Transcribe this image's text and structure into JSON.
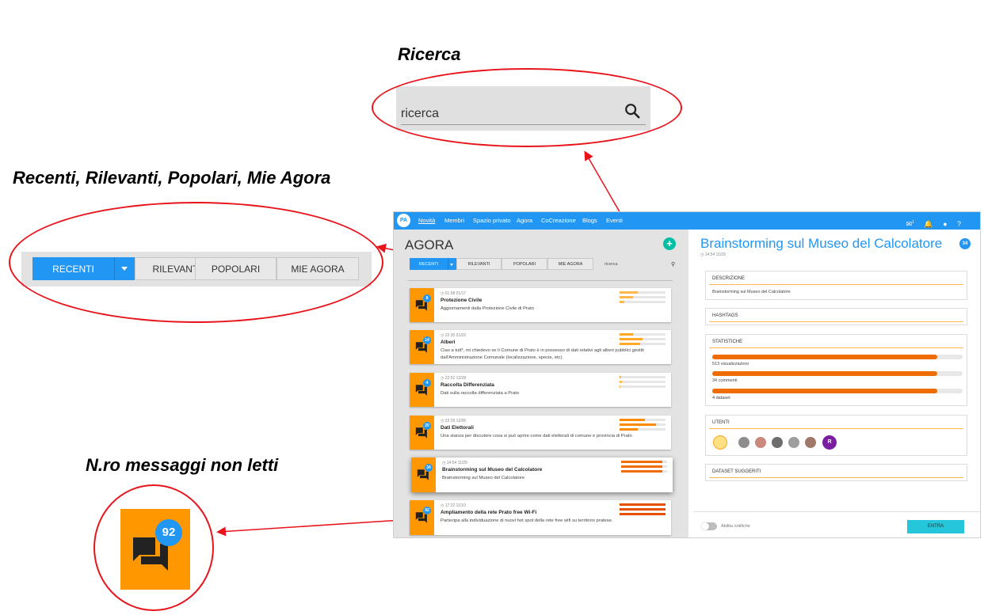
{
  "callouts": {
    "search_title": "Ricerca",
    "tabs_title": "Recenti, Rilevanti, Popolari, Mie Agora",
    "unread_title": "N.ro messaggi non letti",
    "search_placeholder": "ricerca",
    "tabs": [
      "RECENTI",
      "RILEVANTI",
      "POPOLARI",
      "MIE AGORA"
    ],
    "unread_count": "92"
  },
  "app": {
    "logo": "PA",
    "nav": [
      "Novità",
      "Membri",
      "Spazio privato",
      "Agora",
      "CoCreazione",
      "Blogs",
      "Eventi"
    ],
    "notif_count": "1",
    "top_icons": [
      "notification-icon",
      "bell-icon",
      "user-icon",
      "help-icon"
    ],
    "help_label": "?",
    "agora_title": "AGORA",
    "add_label": "+",
    "tabs": [
      "RECENTI",
      "RILEVANTI",
      "POPOLARI",
      "MIE AGORA"
    ],
    "search_placeholder": "ricerca",
    "cards": [
      {
        "count": "8",
        "meta": "01:58 01/17",
        "title": "Protezione Civile",
        "desc": "Aggiornamenti dalla Protezione Civile di Prato"
      },
      {
        "count": "14",
        "meta": "22:30 01/02",
        "title": "Alberi",
        "desc": "Ciao a tutt*, mi chiedevo se il Comune di Prato è in possesso di dati relativi agli alberi pubblici gestiti dall'Amministrazione Comunale (localizzazione, specie, etc)."
      },
      {
        "count": "4",
        "meta": "22:52 12/28",
        "title": "Raccolta Differenziata",
        "desc": "Dati sulla raccolta differenziata a Prato"
      },
      {
        "count": "20",
        "meta": "22:29 12/06",
        "title": "Dati Elettorali",
        "desc": "Una stanza per discutere cosa si può aprire come dati elettorali di comune e provincia di Prato"
      },
      {
        "count": "34",
        "meta": "14:54 11/29",
        "title": "Brainstorming sul Museo del Calcolatore",
        "desc": "Brainstorming sul Museo del Calcolatore"
      },
      {
        "count": "92",
        "meta": "17:22 11/10",
        "title": "Ampliamento della rete Prato free Wi-Fi",
        "desc": "Partecipa alla individuazione di nuovi hot spot della rete free wifi su territorio pratese."
      }
    ],
    "detail": {
      "title": "Brainstorming sul Museo del Calcolatore",
      "badge": "34",
      "time": "14:54 11/29",
      "descrizione_label": "DESCRIZIONE",
      "descrizione": "Brainstorming sul Museo del Calcolatore",
      "hashtags_label": "HASHTAGS",
      "statistiche_label": "STATISTICHE",
      "stats": [
        {
          "label": "513 visualizzazioni",
          "fill": 0.9
        },
        {
          "label": "34 commenti",
          "fill": 0.9
        },
        {
          "label": "4 dataset",
          "fill": 0.9
        }
      ],
      "utenti_label": "UTENTI",
      "user_initial": "R",
      "dataset_label": "DATASET SUGGERITI",
      "toggle_label": "Abilita notifiche",
      "enter_label": "ENTRA"
    }
  },
  "colors": {
    "accent": "#2196f3",
    "orange": "#ff9800",
    "annotation": "#e8141c",
    "teal": "#26c6da"
  }
}
